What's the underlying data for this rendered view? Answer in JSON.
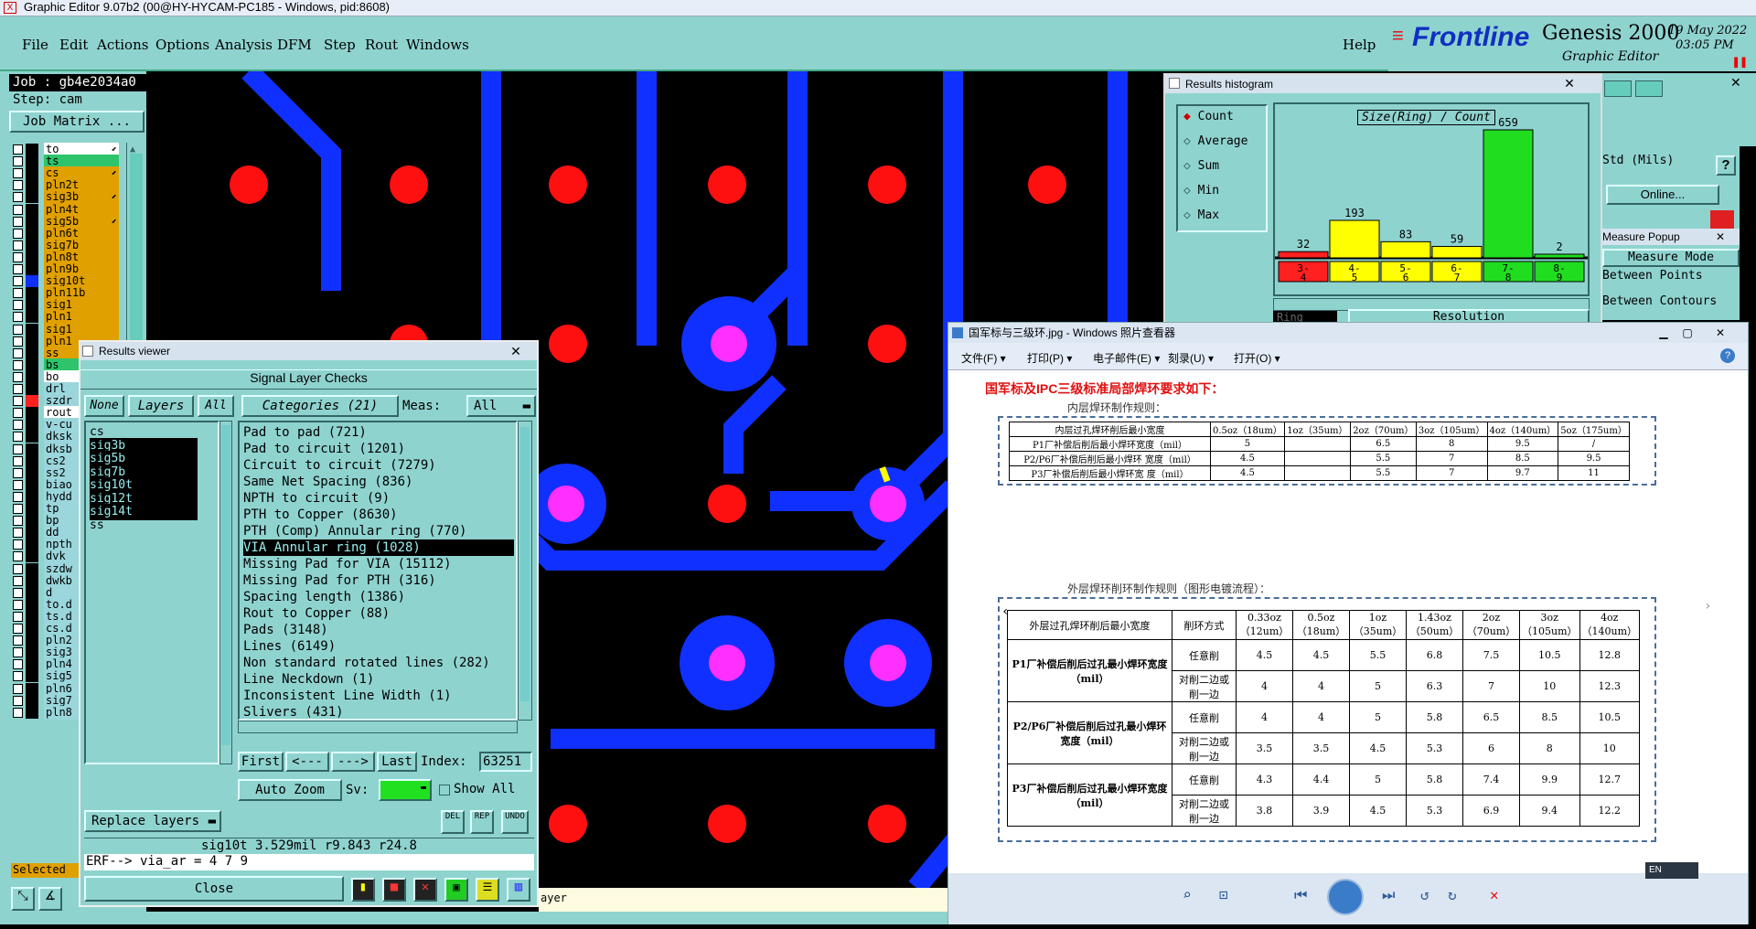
{
  "window": {
    "title": "Graphic Editor 9.07b2 (00@HY-HYCAM-PC185 - Windows, pid:8608)"
  },
  "menu": {
    "items": [
      "File",
      "Edit",
      "Actions",
      "Options",
      "Analysis",
      "DFM",
      "Step",
      "Rout",
      "Windows"
    ],
    "help": "Help"
  },
  "brand": {
    "logo": "Frontline",
    "product": "Genesis 2000",
    "subtitle": "Graphic Editor",
    "date": "19 May 2022",
    "time": "03:05 PM"
  },
  "job": {
    "job": "Job : gb4e2034a0",
    "step": "Step: cam",
    "matrix_button": "Job Matrix ..."
  },
  "layers": [
    {
      "name": "to",
      "color": "#000000",
      "bg": "#ffffff",
      "mark": "⬋"
    },
    {
      "name": "ts",
      "color": "#000000",
      "bg": "#2ec46b",
      "mark": ""
    },
    {
      "name": "cs",
      "color": "#000000",
      "bg": "#e0a000",
      "mark": "⬋"
    },
    {
      "name": "pln2t",
      "color": "#000000",
      "bg": "#e0a000",
      "mark": ""
    },
    {
      "name": "sig3b",
      "color": "#000000",
      "bg": "#e0a000",
      "mark": "⬋"
    },
    {
      "name": "pln4t",
      "color": "#000000",
      "bg": "#e0a000",
      "mark": ""
    },
    {
      "name": "sig5b",
      "color": "#000000",
      "bg": "#e0a000",
      "mark": "⬋"
    },
    {
      "name": "pln6t",
      "color": "#000000",
      "bg": "#e0a000",
      "mark": ""
    },
    {
      "name": "sig7b",
      "color": "#000000",
      "bg": "#e0a000",
      "mark": ""
    },
    {
      "name": "pln8t",
      "color": "#000000",
      "bg": "#e0a000",
      "mark": ""
    },
    {
      "name": "pln9b",
      "color": "#000000",
      "bg": "#e0a000",
      "mark": ""
    },
    {
      "name": "sig10t",
      "color": "#1030ff",
      "bg": "#e0a000",
      "mark": ""
    },
    {
      "name": "pln11b",
      "color": "#000000",
      "bg": "#e0a000",
      "mark": ""
    },
    {
      "name": "sig1",
      "color": "#000000",
      "bg": "#e0a000",
      "mark": ""
    },
    {
      "name": "pln1",
      "color": "#000000",
      "bg": "#e0a000",
      "mark": ""
    },
    {
      "name": "sig1",
      "color": "#000000",
      "bg": "#e0a000",
      "mark": ""
    },
    {
      "name": "pln1",
      "color": "#000000",
      "bg": "#e0a000",
      "mark": ""
    },
    {
      "name": "ss",
      "color": "#000000",
      "bg": "#e0a000",
      "mark": ""
    },
    {
      "name": "bs",
      "color": "#000000",
      "bg": "#2ec46b",
      "mark": ""
    },
    {
      "name": "bo",
      "color": "#000000",
      "bg": "#ffffff",
      "mark": ""
    },
    {
      "name": "drl",
      "color": "#000000",
      "bg": "#9ad6dc",
      "mark": ""
    },
    {
      "name": "szdr",
      "color": "#ff2020",
      "bg": "#9ad6dc",
      "mark": ""
    },
    {
      "name": "rout",
      "color": "#000000",
      "bg": "#ffffff",
      "mark": ""
    },
    {
      "name": "v-cu",
      "color": "#000000",
      "bg": "#9ad6dc",
      "mark": ""
    },
    {
      "name": "dksk",
      "color": "#000000",
      "bg": "#9ad6dc",
      "mark": ""
    },
    {
      "name": "dksb",
      "color": "#000000",
      "bg": "#9ad6dc",
      "mark": ""
    },
    {
      "name": "cs2",
      "color": "#000000",
      "bg": "#9ad6dc",
      "mark": ""
    },
    {
      "name": "ss2",
      "color": "#000000",
      "bg": "#9ad6dc",
      "mark": ""
    },
    {
      "name": "biao",
      "color": "#000000",
      "bg": "#9ad6dc",
      "mark": ""
    },
    {
      "name": "hydd",
      "color": "#000000",
      "bg": "#9ad6dc",
      "mark": ""
    },
    {
      "name": "tp",
      "color": "#000000",
      "bg": "#9ad6dc",
      "mark": ""
    },
    {
      "name": "bp",
      "color": "#000000",
      "bg": "#9ad6dc",
      "mark": ""
    },
    {
      "name": "dd",
      "color": "#000000",
      "bg": "#9ad6dc",
      "mark": ""
    },
    {
      "name": "npth",
      "color": "#000000",
      "bg": "#9ad6dc",
      "mark": ""
    },
    {
      "name": "dvk",
      "color": "#000000",
      "bg": "#9ad6dc",
      "mark": ""
    },
    {
      "name": "szdw",
      "color": "#000000",
      "bg": "#9ad6dc",
      "mark": ""
    },
    {
      "name": "dwkb",
      "color": "#000000",
      "bg": "#9ad6dc",
      "mark": ""
    },
    {
      "name": "d",
      "color": "#000000",
      "bg": "#9ad6dc",
      "mark": ""
    },
    {
      "name": "to.d",
      "color": "#000000",
      "bg": "#9ad6dc",
      "mark": ""
    },
    {
      "name": "ts.d",
      "color": "#000000",
      "bg": "#9ad6dc",
      "mark": ""
    },
    {
      "name": "cs.d",
      "color": "#000000",
      "bg": "#9ad6dc",
      "mark": ""
    },
    {
      "name": "pln2",
      "color": "#000000",
      "bg": "#9ad6dc",
      "mark": ""
    },
    {
      "name": "sig3",
      "color": "#000000",
      "bg": "#9ad6dc",
      "mark": ""
    },
    {
      "name": "pln4",
      "color": "#000000",
      "bg": "#9ad6dc",
      "mark": ""
    },
    {
      "name": "sig5",
      "color": "#000000",
      "bg": "#9ad6dc",
      "mark": ""
    },
    {
      "name": "pln6",
      "color": "#000000",
      "bg": "#9ad6dc",
      "mark": ""
    },
    {
      "name": "sig7",
      "color": "#000000",
      "bg": "#9ad6dc",
      "mark": ""
    },
    {
      "name": "pln8",
      "color": "#000000",
      "bg": "#9ad6dc",
      "mark": ""
    }
  ],
  "left_footer": {
    "selected": "Selected"
  },
  "results_viewer": {
    "title": "Results viewer",
    "header": "Signal Layer Checks",
    "none": "None",
    "layers": "Layers",
    "all": "All",
    "categories": "Categories (21)",
    "meas": "Meas:",
    "meas_value": "All",
    "layer_list": [
      "cs",
      "sig3b",
      "sig5b",
      "sig7b",
      "sig10t",
      "sig12t",
      "sig14t",
      "ss"
    ],
    "category_list": [
      "Pad to pad (721)",
      "Pad to circuit (1201)",
      "Circuit to circuit (7279)",
      "Same Net Spacing (836)",
      "NPTH to circuit (9)",
      "PTH to Copper (8630)",
      "PTH (Comp) Annular ring (770)",
      "VIA Annular ring (1028)",
      "Missing Pad for VIA (15112)",
      "Missing Pad for PTH (316)",
      "Spacing length (1386)",
      "Rout to Copper (88)",
      "Pads (3148)",
      "Lines (6149)",
      "Non standard rotated lines (282)",
      "Line Neckdown (1)",
      "Inconsistent Line Width (1)",
      "Slivers (431)"
    ],
    "first": "First",
    "prev": "<---",
    "next": "--->",
    "last": "Last",
    "index_label": "Index:",
    "index_value": "63251",
    "auto_zoom": "Auto Zoom",
    "sv": "Sv:",
    "show_all": "Show All",
    "replace_layers": "Replace layers",
    "status": "sig10t 3.529mil   r9.843   r24.8",
    "erf": "ERF--> via_ar = 4 7 9",
    "close": "Close"
  },
  "histogram": {
    "title": "Results histogram",
    "options": [
      "Count",
      "Average",
      "Sum",
      "Min",
      "Max"
    ],
    "chart_title": "Size(Ring) / Count",
    "resolution": "Resolution",
    "ring": "Ring"
  },
  "chart_data": {
    "type": "bar",
    "title": "Size(Ring) / Count",
    "categories": [
      "3-4",
      "4-5",
      "5-6",
      "6-7",
      "7-8",
      "8-9"
    ],
    "values": [
      32,
      193,
      83,
      59,
      659,
      2
    ],
    "colors": [
      "#ff2020",
      "#ffff00",
      "#ffff00",
      "#ffff00",
      "#20dd20",
      "#20dd20"
    ],
    "grid": false
  },
  "measure": {
    "std": "Std (Mils)",
    "online": "Online...",
    "popup": "Measure Popup",
    "mode": "Measure Mode",
    "between_points": "Between Points",
    "between_contours": "Between Contours",
    "bottom_fragment": "ayer"
  },
  "photo_viewer": {
    "title": "国军标与三级环.jpg - Windows 照片查看器",
    "menu": [
      "文件(F)",
      "打印(P)",
      "电子邮件(E)",
      "刻录(U)",
      "打开(O)"
    ],
    "heading": "国军标及IPC三级标准局部焊环要求如下：",
    "inner_title": "内层焊环制作规则：",
    "inner_header": [
      "内层过孔焊环削后最小宽度",
      "0.5oz（18um）",
      "1oz（35um）",
      "2oz（70um）",
      "3oz（105um）",
      "4oz（140um）",
      "5oz（175um）"
    ],
    "inner_rows": [
      [
        "P1厂补偿后削后最小焊环宽度（mil）",
        "5",
        "",
        "6.5",
        "8",
        "9.5",
        "/"
      ],
      [
        "P2/P6厂补偿后削后最小焊环 宽度（mil）",
        "4.5",
        "",
        "5.5",
        "7",
        "8.5",
        "9.5"
      ],
      [
        "P3厂补偿后削后最小焊环宽 度（mil）",
        "4.5",
        "",
        "5.5",
        "7",
        "9.7",
        "11"
      ]
    ],
    "outer_title": "外层焊环削环制作规则（图形电镀流程）：",
    "outer_header": [
      "外层过孔焊环削后最小宽度",
      "削环方式",
      "0.33oz（12um）",
      "0.5oz（18um）",
      "1oz（35um）",
      "1.43oz（50um）",
      "2oz（70um）",
      "3oz（105um）",
      "4oz（140um）"
    ],
    "outer_groups": [
      {
        "label": "P1厂补偿后削后过孔最小焊环宽度（mil）",
        "rows": [
          [
            "任意削",
            "4.5",
            "4.5",
            "5.5",
            "6.8",
            "7.5",
            "10.5",
            "12.8"
          ],
          [
            "对削二边或削一边",
            "4",
            "4",
            "5",
            "6.3",
            "7",
            "10",
            "12.3"
          ]
        ]
      },
      {
        "label": "P2/P6厂补偿后削后过孔最小焊环宽度（mil）",
        "rows": [
          [
            "任意削",
            "4",
            "4",
            "5",
            "5.8",
            "6.5",
            "8.5",
            "10.5"
          ],
          [
            "对削二边或削一边",
            "3.5",
            "3.5",
            "4.5",
            "5.3",
            "6",
            "8",
            "10"
          ]
        ]
      },
      {
        "label": "P3厂补偿后削后过孔最小焊环宽度（mil）",
        "rows": [
          [
            "任意削",
            "4.3",
            "4.4",
            "5",
            "5.8",
            "7.4",
            "9.9",
            "12.7"
          ],
          [
            "对削二边或削一边",
            "3.8",
            "3.9",
            "4.5",
            "5.3",
            "6.9",
            "9.4",
            "12.2"
          ]
        ]
      }
    ],
    "lang": "EN"
  }
}
